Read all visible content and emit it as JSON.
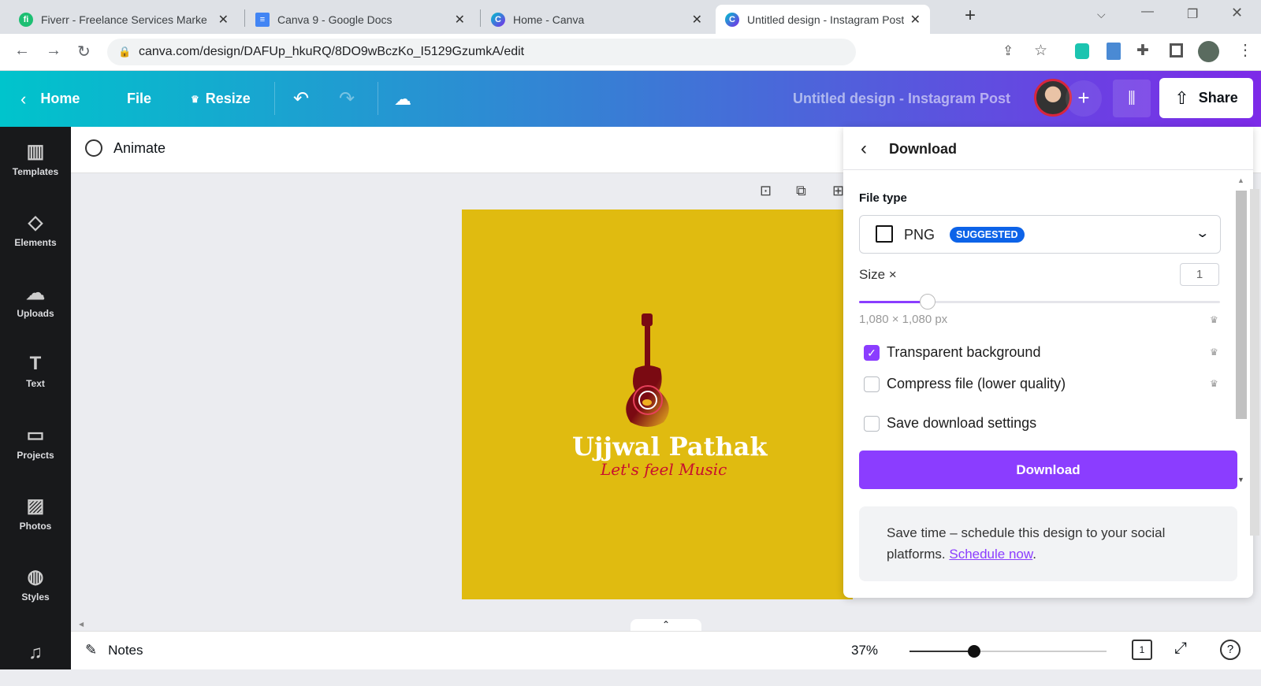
{
  "browser": {
    "tabs": [
      {
        "title": "Fiverr - Freelance Services Marke",
        "icon": "fiverr-icon",
        "color": "#1dbf73"
      },
      {
        "title": "Canva 9 - Google Docs",
        "icon": "google-docs-icon",
        "color": "#4285f4"
      },
      {
        "title": "Home - Canva",
        "icon": "canva-icon",
        "color": "#7d2ae8"
      },
      {
        "title": "Untitled design - Instagram Post",
        "icon": "canva-icon",
        "color": "#7d2ae8"
      }
    ],
    "url": "canva.com/design/DAFUp_hkuRQ/8DO9wBczKo_I5129GzumkA/edit"
  },
  "header": {
    "home": "Home",
    "file": "File",
    "resize": "Resize",
    "title": "Untitled design - Instagram Post",
    "share": "Share"
  },
  "sidebar": {
    "items": [
      {
        "label": "Templates",
        "icon": "templates-icon",
        "glyph": "▥"
      },
      {
        "label": "Elements",
        "icon": "elements-icon",
        "glyph": "◇"
      },
      {
        "label": "Uploads",
        "icon": "upload-cloud-icon",
        "glyph": "☁"
      },
      {
        "label": "Text",
        "icon": "text-icon",
        "glyph": "T"
      },
      {
        "label": "Projects",
        "icon": "folder-icon",
        "glyph": "▭"
      },
      {
        "label": "Photos",
        "icon": "photos-icon",
        "glyph": "▨"
      },
      {
        "label": "Styles",
        "icon": "palette-icon",
        "glyph": "◍"
      },
      {
        "label": "",
        "icon": "music-icon",
        "glyph": "♫"
      }
    ]
  },
  "toolbar": {
    "animate": "Animate"
  },
  "design": {
    "name": "Ujjwal Pathak",
    "tagline": "Let's feel Music",
    "background": "#e0bb10"
  },
  "panel": {
    "title": "Download",
    "file_type_label": "File type",
    "file_type": "PNG",
    "badge": "SUGGESTED",
    "size_label": "Size ×",
    "size_value": "1",
    "size_slider_fraction": 0.19,
    "dimensions": "1,080 × 1,080 px",
    "options": [
      {
        "label": "Transparent background",
        "checked": true,
        "premium": true
      },
      {
        "label": "Compress file (lower quality)",
        "checked": false,
        "premium": true
      },
      {
        "label": "Save download settings",
        "checked": false,
        "premium": false
      }
    ],
    "download_button": "Download",
    "info_text": "Save time – schedule this design to your social platforms. ",
    "info_link": "Schedule now",
    "info_end": ".",
    "accent": "#8b3dff"
  },
  "bottom": {
    "notes": "Notes",
    "zoom": "37%",
    "page": "1"
  }
}
